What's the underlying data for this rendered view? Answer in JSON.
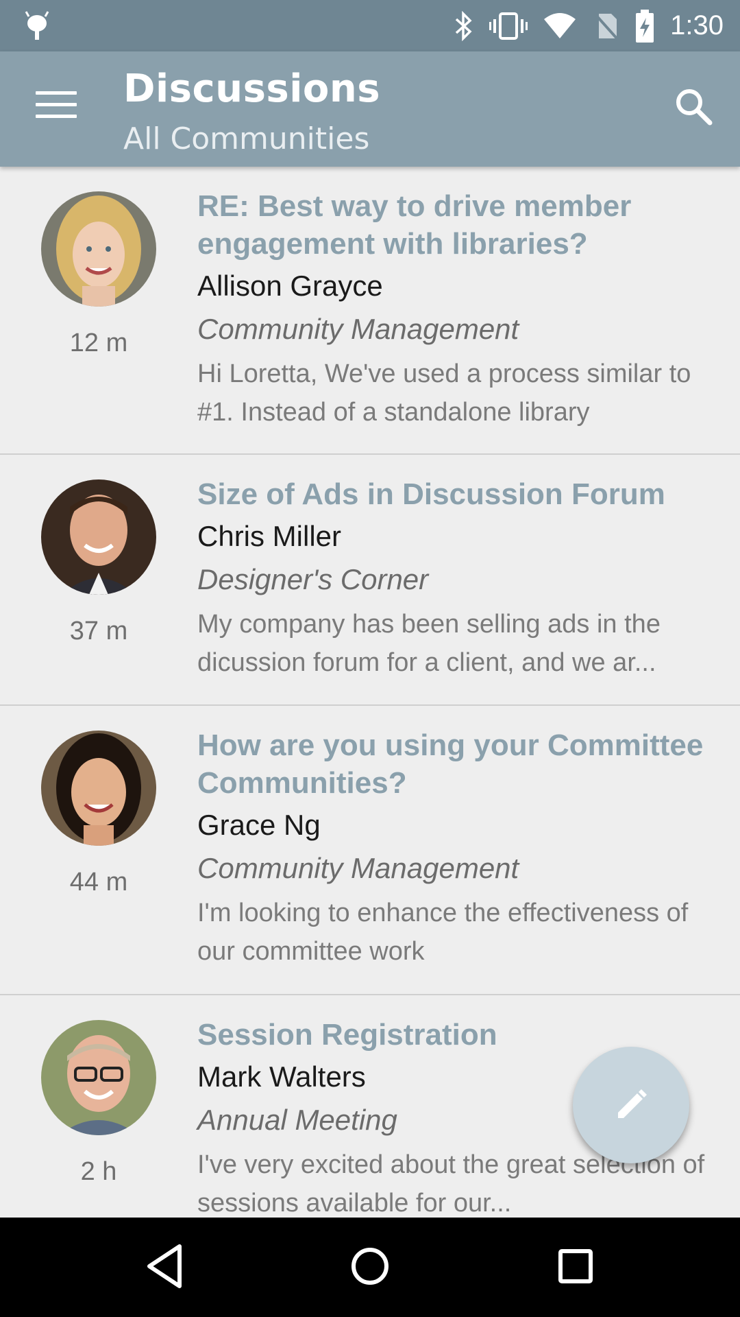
{
  "status_bar": {
    "time": "1:30",
    "icons": [
      "android-debug-icon",
      "bluetooth-icon",
      "vibrate-icon",
      "wifi-icon",
      "no-sim-icon",
      "battery-charging-icon"
    ]
  },
  "app_bar": {
    "title": "Discussions",
    "subtitle": "All Communities",
    "menu_icon": "menu-icon",
    "search_icon": "search-icon",
    "background": "#8aa0ac"
  },
  "discussions": [
    {
      "subject": "RE: Best way to drive member engagement with libraries?",
      "author": "Allison Grayce",
      "community": "Community Management",
      "snippet": "Hi Loretta, We've used a process similar to #1. Instead of a standalone library",
      "time": "12 m"
    },
    {
      "subject": "Size of Ads in Discussion Forum",
      "author": "Chris Miller",
      "community": "Designer's Corner",
      "snippet": "My company has been selling ads in the dicussion forum for a client, and we ar...",
      "time": "37 m"
    },
    {
      "subject": "How are you using your Committee Communities?",
      "author": "Grace Ng",
      "community": "Community Management",
      "snippet": "I'm looking to enhance the effectiveness of our committee work",
      "time": "44 m"
    },
    {
      "subject": "Session Registration",
      "author": "Mark Walters",
      "community": "Annual Meeting",
      "snippet": "I've very excited about the great selection of sessions available for our...",
      "time": "2 h"
    }
  ],
  "fab": {
    "icon": "pencil-icon"
  },
  "nav_bar": {
    "icons": [
      "back-icon",
      "home-icon",
      "recents-icon"
    ]
  },
  "colors": {
    "accent": "#8aa0ac",
    "status_bar": "#6f8693",
    "fab": "#c7d5dd"
  }
}
